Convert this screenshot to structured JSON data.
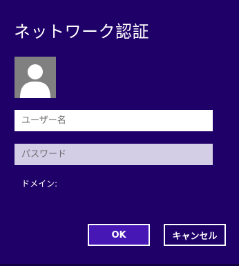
{
  "dialog": {
    "title": "ネットワーク認証",
    "username_placeholder": "ユーザー名",
    "username_value": "",
    "password_placeholder": "パスワード",
    "password_value": "",
    "domain_label": "ドメイン:",
    "ok_label": "OK",
    "cancel_label": "キャンセル",
    "avatar_icon": "user-silhouette-icon"
  },
  "colors": {
    "background": "#1f0068",
    "ok_button": "#4617b4",
    "password_field": "#d4cde6",
    "avatar_bg": "#808080"
  }
}
